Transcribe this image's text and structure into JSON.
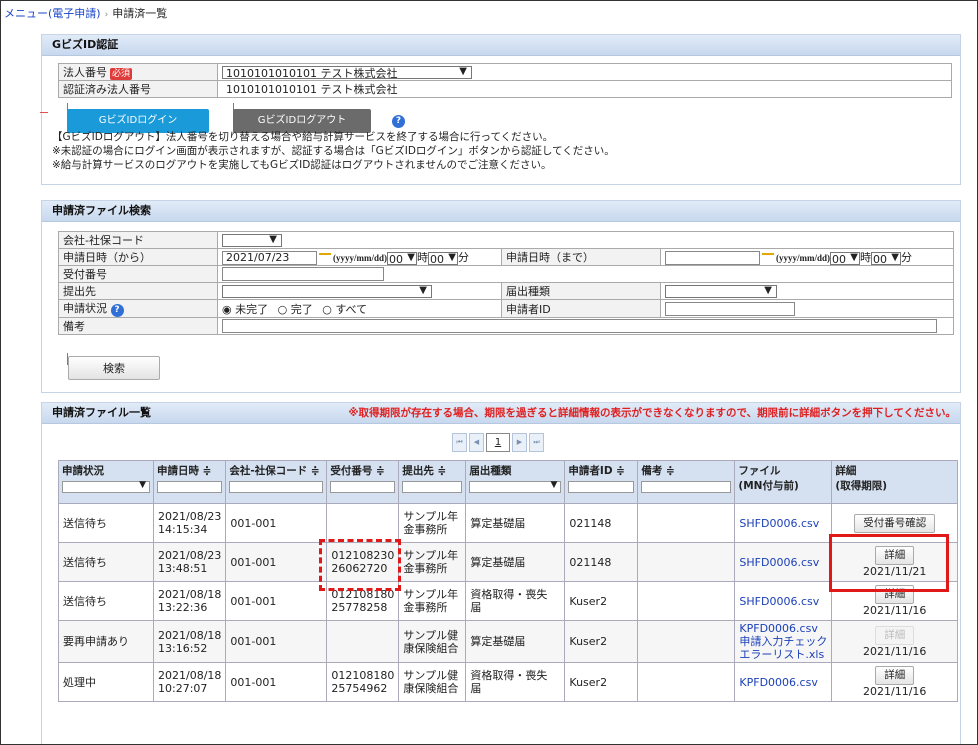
{
  "breadcrumb": {
    "menu": "メニュー(電子申請)",
    "current": "申請済一覧"
  },
  "auth": {
    "title": "GビズID認証",
    "corp_no_label": "法人番号",
    "required_badge": "必須",
    "corp_no_value": "1010101010101 テスト株式会社",
    "certified_label": "認証済み法人番号",
    "certified_value": "1010101010101 テスト株式会社",
    "login_label": "GビズIDログイン",
    "logout_label": "GビズIDログアウト",
    "notes": [
      "【GビズIDログアウト】法人番号を切り替える場合や給与計算サービスを終了する場合に行ってください。",
      "※未認証の場合にログイン画面が表示されますが、認証する場合は「GビズIDログイン」ボタンから認証してください。",
      "※給与計算サービスのログアウトを実施してもGビズID認証はログアウトされませんのでご注意ください。"
    ]
  },
  "search": {
    "title": "申請済ファイル検索",
    "company_code_label": "会社-社保コード",
    "from_label": "申請日時（から）",
    "from_date": "2021/07/23",
    "date_format": "(yyyy/mm/dd)",
    "hour_value": "00",
    "hour_unit": "時",
    "minute_value": "00",
    "minute_unit": "分",
    "to_label": "申請日時（まで）",
    "receipt_label": "受付番号",
    "dest_label": "提出先",
    "form_type_label": "届出種類",
    "status_label": "申請状況",
    "status_options": [
      "未完了",
      "完了",
      "すべて"
    ],
    "applicant_label": "申請者ID",
    "remarks_label": "備考",
    "search_button": "検索"
  },
  "list": {
    "title": "申請済ファイル一覧",
    "warning": "※取得期限が存在する場合、期限を過ぎると詳細情報の表示ができなくなりますので、期限前に詳細ボタンを押下してください。",
    "page": "1",
    "headers": {
      "status": "申請状況",
      "datetime": "申請日時 ≑",
      "company": "会社-社保コード ≑",
      "receipt": "受付番号 ≑",
      "dest": "提出先 ≑",
      "form": "届出種類",
      "applicant": "申請者ID ≑",
      "remarks": "備考 ≑",
      "file1": "ファイル",
      "file2": "(MN付与前)",
      "detail1": "詳細",
      "detail2": "(取得期限)"
    },
    "rows": [
      {
        "status": "送信待ち",
        "date": "2021/08/23",
        "time": "14:15:34",
        "company": "001-001",
        "receipt1": "",
        "receipt2": "",
        "dest1": "サンプル年",
        "dest2": "金事務所",
        "form1": "算定基礎届",
        "form2": "",
        "applicant": "021148",
        "file1": "SHFD0006.csv",
        "file2": "",
        "file3": "",
        "button": "受付番号確認",
        "deadline": ""
      },
      {
        "status": "送信待ち",
        "date": "2021/08/23",
        "time": "13:48:51",
        "company": "001-001",
        "receipt1": "012108230",
        "receipt2": "26062720",
        "dest1": "サンプル年",
        "dest2": "金事務所",
        "form1": "算定基礎届",
        "form2": "",
        "applicant": "021148",
        "file1": "SHFD0006.csv",
        "file2": "",
        "file3": "",
        "button": "詳細",
        "deadline": "2021/11/21"
      },
      {
        "status": "送信待ち",
        "date": "2021/08/18",
        "time": "13:22:36",
        "company": "001-001",
        "receipt1": "012108180",
        "receipt2": "25778258",
        "dest1": "サンプル年",
        "dest2": "金事務所",
        "form1": "資格取得・喪失",
        "form2": "届",
        "applicant": "Kuser2",
        "file1": "SHFD0006.csv",
        "file2": "",
        "file3": "",
        "button": "詳細",
        "deadline": "2021/11/16"
      },
      {
        "status": "要再申請あり",
        "date": "2021/08/18",
        "time": "13:16:52",
        "company": "001-001",
        "receipt1": "",
        "receipt2": "",
        "dest1": "サンプル健",
        "dest2": "康保険組合",
        "form1": "算定基礎届",
        "form2": "",
        "applicant": "Kuser2",
        "file1": "KPFD0006.csv",
        "file2": "申請入力チェック",
        "file3": "エラーリスト.xls",
        "button": "詳細",
        "deadline": "2021/11/16"
      },
      {
        "status": "処理中",
        "date": "2021/08/18",
        "time": "10:27:07",
        "company": "001-001",
        "receipt1": "012108180",
        "receipt2": "25754962",
        "dest1": "サンプル健",
        "dest2": "康保険組合",
        "form1": "資格取得・喪失",
        "form2": "届",
        "applicant": "Kuser2",
        "file1": "KPFD0006.csv",
        "file2": "",
        "file3": "",
        "button": "詳細",
        "deadline": "2021/11/16"
      }
    ]
  },
  "colors": {
    "accent_blue": "#1b9ad9",
    "logout_gray": "#6b6b6b",
    "warning_red": "#e02020",
    "header_bg": "#d5e1f1"
  }
}
